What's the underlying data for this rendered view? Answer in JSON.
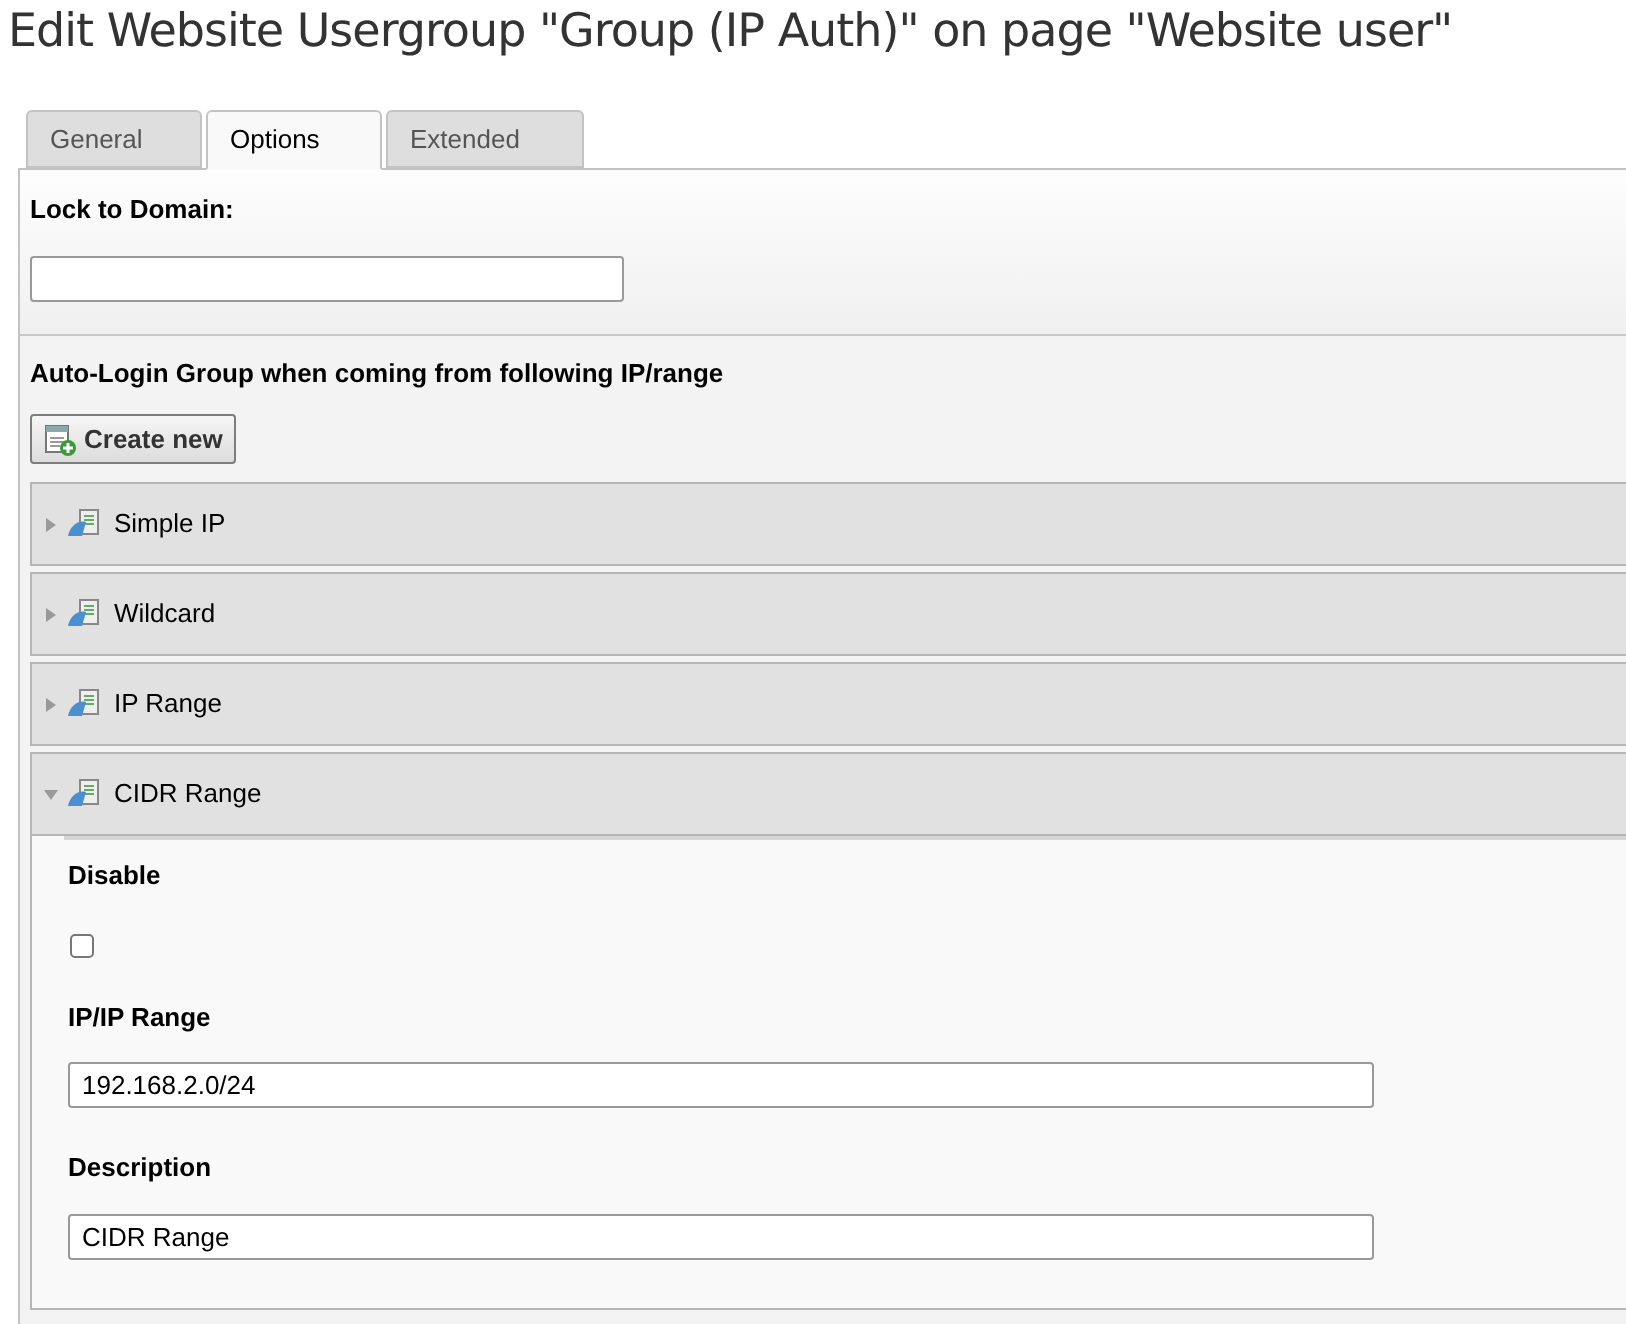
{
  "title": "Edit Website Usergroup \"Group (IP Auth)\" on page \"Website user\"",
  "tabs": [
    {
      "label": "General",
      "selected": false
    },
    {
      "label": "Options",
      "selected": true
    },
    {
      "label": "Extended",
      "selected": false
    }
  ],
  "lock_to_domain": {
    "label": "Lock to Domain:"
  },
  "auto_login": {
    "label": "Auto-Login Group when coming from following IP/range",
    "create_button": "Create new",
    "records": [
      {
        "title": "Simple IP",
        "expanded": false
      },
      {
        "title": "Wildcard",
        "expanded": false
      },
      {
        "title": "IP Range",
        "expanded": false
      },
      {
        "title": "CIDR Range",
        "expanded": true,
        "fields": [
          {
            "kind": "checkbox",
            "label": "Disable",
            "checked": false
          },
          {
            "kind": "text",
            "label": "IP/IP Range",
            "value": "192.168.2.0/24"
          },
          {
            "kind": "text",
            "label": "Description",
            "value": "CIDR Range"
          }
        ]
      }
    ]
  }
}
